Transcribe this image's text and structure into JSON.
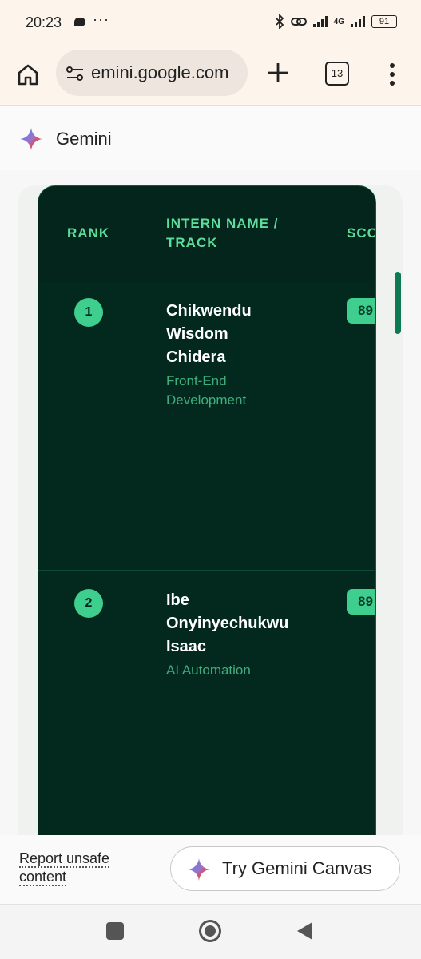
{
  "status_bar": {
    "time": "20:23",
    "more": "···",
    "network": "4G",
    "battery": "91"
  },
  "browser": {
    "url": "emini.google.com",
    "tab_count": "13"
  },
  "app": {
    "title": "Gemini"
  },
  "table": {
    "headers": {
      "rank": "RANK",
      "name": "INTERN NAME / TRACK",
      "score": "SCO"
    },
    "rows": [
      {
        "rank": "1",
        "name": "Chikwendu Wisdom Chidera",
        "track": "Front-End Development",
        "score": "89"
      },
      {
        "rank": "2",
        "name": "Ibe Onyinyechukwu Isaac",
        "track": "AI Automation",
        "score": "89"
      }
    ]
  },
  "footer": {
    "report": "Report unsafe content",
    "try_canvas": "Try Gemini Canvas"
  },
  "colors": {
    "card_bg": "#03291f",
    "accent": "#3ecf8e",
    "header_text": "#5edc9c",
    "track_text": "#3fae7c"
  }
}
